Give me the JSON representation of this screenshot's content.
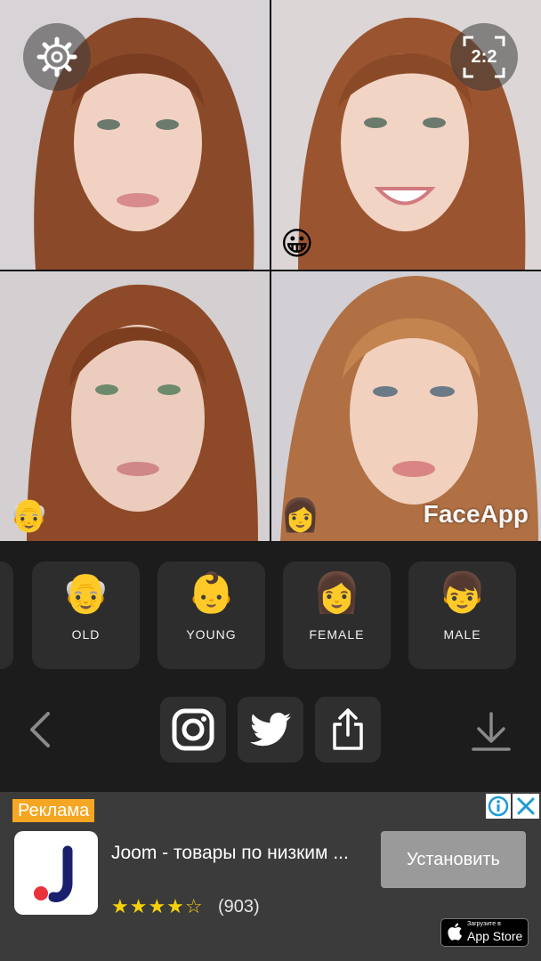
{
  "photos": {
    "tiles": [
      {
        "emoji": ""
      },
      {
        "emoji": "😀"
      },
      {
        "emoji": "👴"
      },
      {
        "emoji": "👩"
      }
    ],
    "ratio_label": "2:2",
    "watermark": "FaceApp"
  },
  "filters": [
    {
      "emoji": "👴",
      "label": "OLD"
    },
    {
      "emoji": "👶",
      "label": "YOUNG"
    },
    {
      "emoji": "👩",
      "label": "FEMALE"
    },
    {
      "emoji": "👦",
      "label": "MALE"
    }
  ],
  "actions": {
    "icons": [
      "instagram-icon",
      "twitter-icon",
      "share-icon"
    ]
  },
  "ad": {
    "badge": "Реклама",
    "title": "Joom - товары по низким ...",
    "stars": "★★★★☆",
    "rating_count": "(903)",
    "install_label": "Установить",
    "appstore_small": "Загрузите в",
    "appstore_big": "App Store",
    "colors": {
      "badge": "#f5a623",
      "install": "#9a9a9a"
    }
  }
}
